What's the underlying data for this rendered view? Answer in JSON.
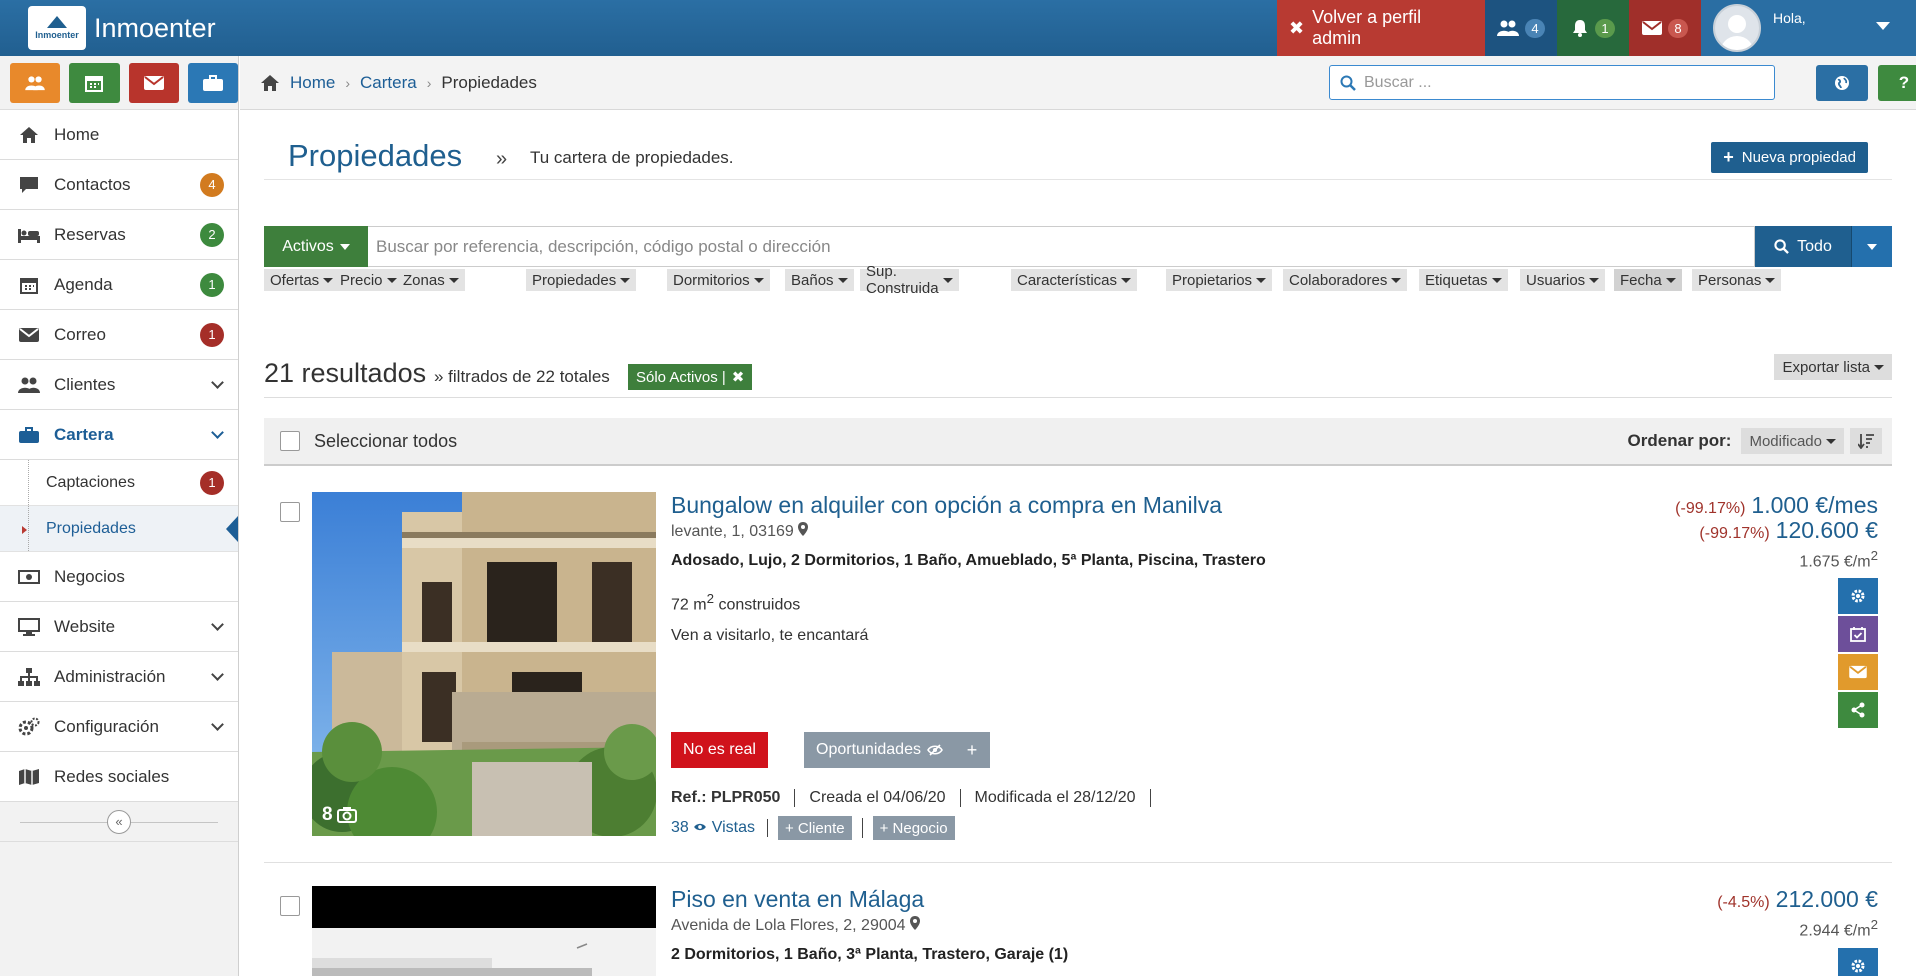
{
  "topbar": {
    "brand_logo_text": "Inmoenter",
    "brand_name": "Inmoenter",
    "admin_label": "Volver a perfil admin",
    "users_count": "4",
    "notifications_count": "1",
    "mail_count": "8",
    "greeting": "Hola,"
  },
  "sidebar": {
    "items": [
      {
        "label": "Home"
      },
      {
        "label": "Contactos",
        "badge": "4"
      },
      {
        "label": "Reservas",
        "badge": "2"
      },
      {
        "label": "Agenda",
        "badge": "1"
      },
      {
        "label": "Correo",
        "badge": "1"
      },
      {
        "label": "Clientes"
      },
      {
        "label": "Cartera"
      },
      {
        "label": "Negocios"
      },
      {
        "label": "Website"
      },
      {
        "label": "Administración"
      },
      {
        "label": "Configuración"
      },
      {
        "label": "Redes sociales"
      }
    ],
    "subitems": [
      {
        "label": "Captaciones",
        "badge": "1"
      },
      {
        "label": "Propiedades"
      }
    ],
    "collapse_glyph": "«"
  },
  "breadcrumb": {
    "home": "Home",
    "cartera": "Cartera",
    "current": "Propiedades",
    "sep": "›"
  },
  "search": {
    "placeholder": "Buscar ..."
  },
  "help_label": "?",
  "page": {
    "title": "Propiedades",
    "raquo": "»",
    "subtitle": "Tu cartera de propiedades.",
    "new_button": "Nueva propiedad"
  },
  "filter": {
    "status_label": "Activos",
    "search_placeholder": "Buscar por referencia, descripción, código postal o dirección",
    "scope_label": "Todo",
    "chips": [
      "Ofertas",
      "Precio",
      "Zonas",
      "Propiedades",
      "Dormitorios",
      "Baños",
      "Sup. Construida",
      "Características",
      "Propietarios",
      "Colaboradores",
      "Etiquetas",
      "Usuarios",
      "Fecha",
      "Personas"
    ]
  },
  "results": {
    "count": "21 resultados",
    "filtered_text": "» filtrados de 22 totales",
    "active_filter": "Sólo Activos |",
    "export": "Exportar lista"
  },
  "selection": {
    "select_all": "Seleccionar todos",
    "order_label": "Ordenar por:",
    "order_value": "Modificado"
  },
  "listings": [
    {
      "title": "Bungalow en alquiler con opción a compra en Manilva",
      "address": "levante, 1, 03169",
      "features": "Adosado, Lujo, 2 Dormitorios, 1 Baño, Amueblado, 5ª Planta, Piscina, Trastero",
      "size_value": "72 m",
      "size_sup": "2",
      "size_suffix": " construidos",
      "description": "Ven a visitarlo, te encantará",
      "photo_count": "8",
      "tag_real": "No es real",
      "tag_oportunidades": "Oportunidades",
      "plus_label": "+",
      "ref_label": "Ref.:",
      "ref": "PLPR050",
      "created": "Creada el 04/06/20",
      "modified": "Modificada el 28/12/20",
      "views": "38",
      "views_label": "Vistas",
      "cliente_btn": "+ Cliente",
      "negocio_btn": "+ Negocio",
      "rent_pct": "(-99.17%)",
      "rent_price": "1.000 €/mes",
      "sale_pct": "(-99.17%)",
      "sale_price": "120.600 €",
      "price_m2": "1.675 €/m",
      "price_m2_sup": "2"
    },
    {
      "title": "Piso en venta en Málaga",
      "address": "Avenida de Lola Flores, 2, 29004",
      "features": "2 Dormitorios, 1 Baño, 3ª Planta, Trastero, Garaje (1)",
      "sale_pct": "(-4.5%)",
      "sale_price": "212.000 €",
      "price_m2": "2.944 €/m",
      "price_m2_sup": "2"
    }
  ],
  "colors": {
    "topbar": "#2b6fa4",
    "admin": "#b83a32",
    "accent_blue": "#1f5f8f",
    "green": "#3e7f3c",
    "red_tag": "#d0121b"
  }
}
